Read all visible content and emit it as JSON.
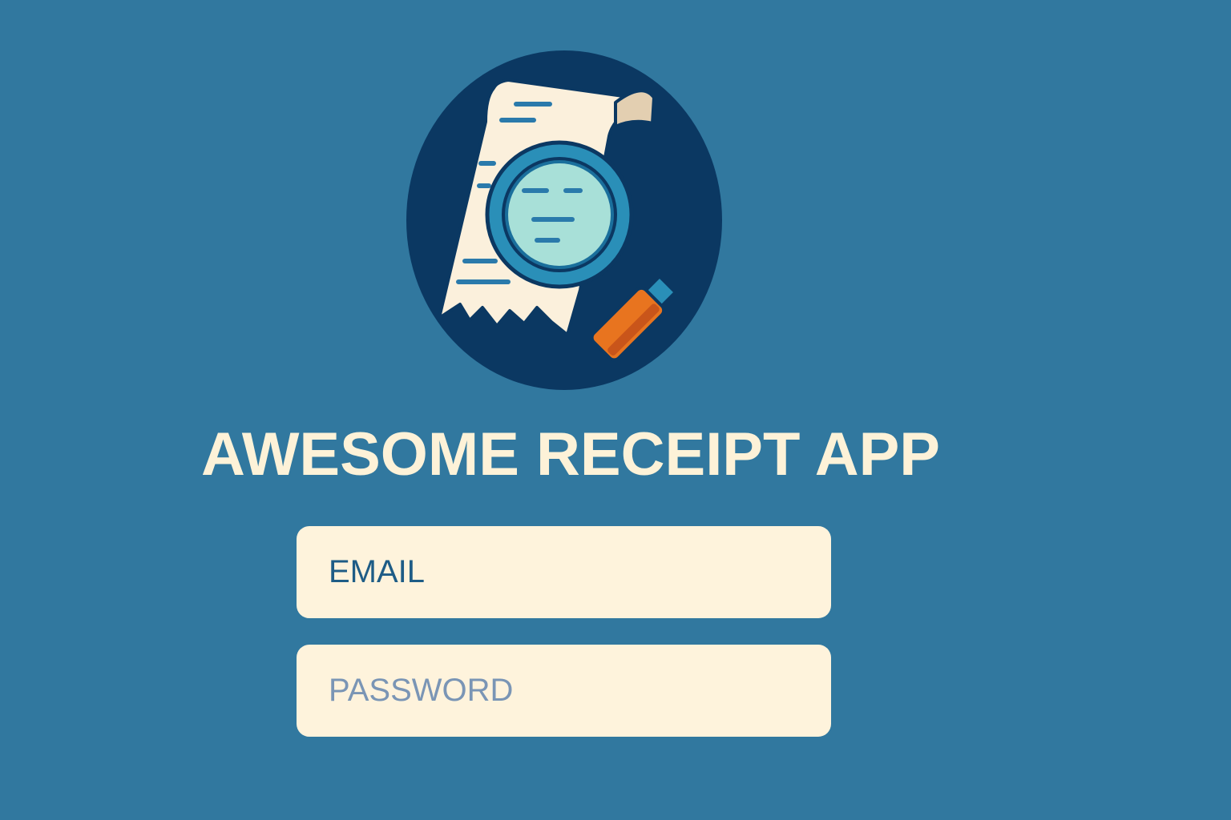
{
  "app": {
    "title": "AWESOME RECEIPT APP",
    "logo_icon": "receipt-magnifier-icon"
  },
  "login_form": {
    "email_placeholder": "EMAIL",
    "password_placeholder": "PASSWORD"
  },
  "colors": {
    "background": "#31789f",
    "logo_circle": "#0b3862",
    "title_text": "#fdf2d8",
    "field_background": "#fef3dc",
    "email_text": "#1e5c86",
    "password_text": "#7a95b5",
    "magnifier_handle": "#e8741f"
  }
}
